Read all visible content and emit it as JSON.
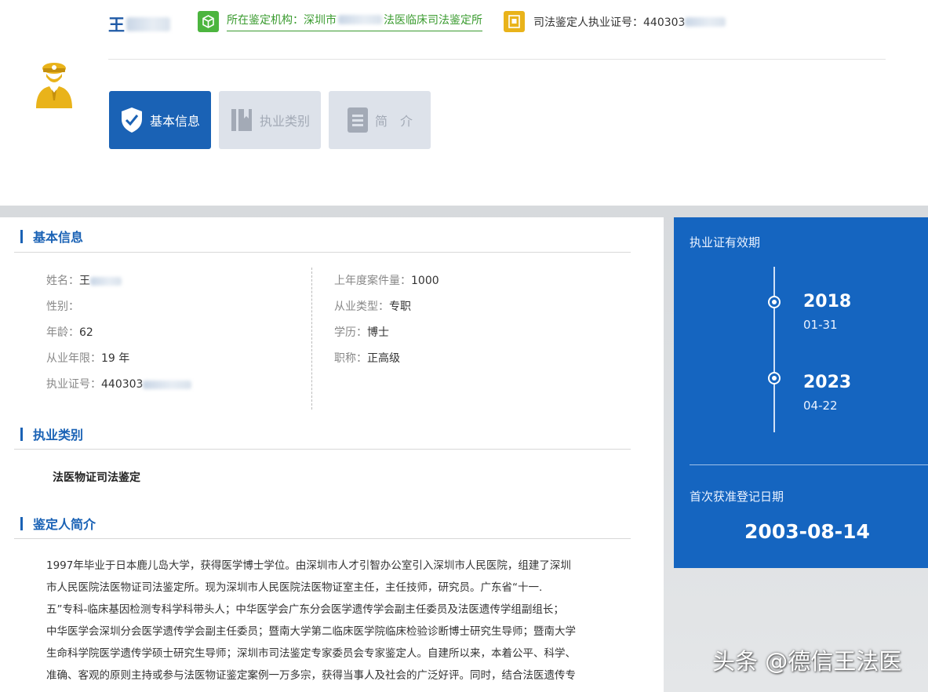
{
  "header": {
    "name": "王",
    "org_text": "所在鉴定机构：深圳市",
    "org_text_suffix": "法医临床司法鉴定所",
    "license_text": "司法鉴定人执业证号：440303",
    "accent_green": "#4cb53f",
    "accent_yellow": "#e9b31a",
    "brand_blue": "#1a62b5"
  },
  "tabs": [
    {
      "label": "基本信息",
      "icon": "shield-check-icon",
      "active": true
    },
    {
      "label": "执业类别",
      "icon": "book-icon",
      "active": false
    },
    {
      "label": "简　介",
      "icon": "document-icon",
      "active": false
    }
  ],
  "basic": {
    "title": "基本信息",
    "left": [
      {
        "label": "姓名：",
        "value": "王"
      },
      {
        "label": "性别：",
        "value": ""
      },
      {
        "label": "年龄：",
        "value": " 62"
      },
      {
        "label": "从业年限：",
        "value": " 19 年"
      },
      {
        "label": "执业证号：",
        "value": "440303"
      }
    ],
    "right": [
      {
        "label": "上年度案件量：",
        "value": "1000"
      },
      {
        "label": "从业类型：",
        "value": " 专职"
      },
      {
        "label": "学历：",
        "value": "博士"
      },
      {
        "label": "职称：",
        "value": "正高级"
      }
    ]
  },
  "category": {
    "title": "执业类别",
    "item": "法医物证司法鉴定"
  },
  "intro": {
    "title": "鉴定人简介",
    "lines": [
      "1997年毕业于日本鹿儿岛大学，获得医学博士学位。由深圳市人才引智办公室引入深圳市人民医院，组建了深圳",
      "市人民医院法医物证司法鉴定所。现为深圳市人民医院法医物证室主任，主任技师，研究员。广东省“十一.",
      "五”专科-临床基因检测专科学科带头人；中华医学会广东分会医学遗传学会副主任委员及法医遗传学组副组长；",
      "中华医学会深圳分会医学遗传学会副主任委员；暨南大学第二临床医学院临床检验诊断博士研究生导师；暨南大学",
      "生命科学院医学遗传学硕士研究生导师；深圳市司法鉴定专家委员会专家鉴定人。自建所以来，本着公平、科学、",
      "准确、客观的原则主持或参与法医物证鉴定案例一万多宗，获得当事人及社会的广泛好评。同时，结合法医遗传专"
    ]
  },
  "side": {
    "validity_label": "执业证有效期",
    "start_year": "2018",
    "start_md": "01-31",
    "end_year": "2023",
    "end_md": "04-22",
    "first_reg_label": "首次获准登记日期",
    "first_reg_date": "2003-08-14"
  },
  "watermark": "头条 @德信王法医"
}
